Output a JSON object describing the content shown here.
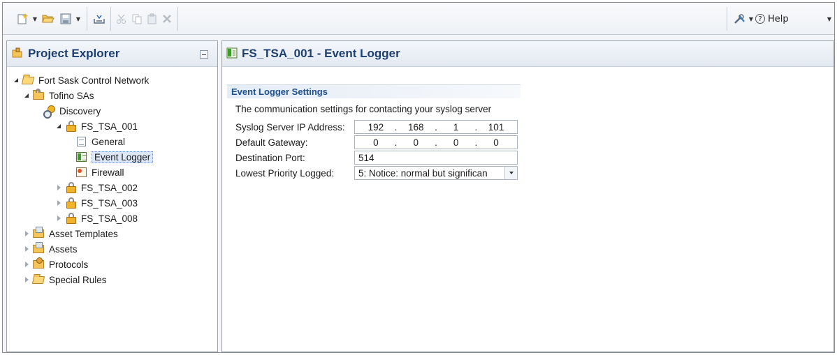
{
  "toolbar": {
    "left_icons": [
      "new-icon",
      "open-folder-icon",
      "save-icon",
      "import-icon",
      "cut-icon",
      "copy-icon",
      "paste-icon",
      "delete-icon"
    ],
    "right_icons": [
      "tools-icon"
    ],
    "help_label": "Help"
  },
  "project_explorer": {
    "title": "Project Explorer",
    "tree": [
      {
        "label": "Fort Sask Control Network",
        "icon": "network-folder-icon",
        "expanded": true
      },
      {
        "label": "Tofino SAs",
        "icon": "tofino-folder-icon",
        "expanded": true
      },
      {
        "label": "Discovery",
        "icon": "discovery-icon"
      },
      {
        "label": "FS_TSA_001",
        "icon": "lock-icon",
        "expanded": true
      },
      {
        "label": "General",
        "icon": "general-document-icon"
      },
      {
        "label": "Event Logger",
        "icon": "event-logger-icon",
        "selected": true
      },
      {
        "label": "Firewall",
        "icon": "firewall-icon"
      },
      {
        "label": "FS_TSA_002",
        "icon": "lock-icon",
        "expanded": false
      },
      {
        "label": "FS_TSA_003",
        "icon": "lock-icon",
        "expanded": false
      },
      {
        "label": "FS_TSA_008",
        "icon": "lock-icon",
        "expanded": false
      },
      {
        "label": "Asset Templates",
        "icon": "asset-templates-folder-icon",
        "expanded": false
      },
      {
        "label": "Assets",
        "icon": "assets-folder-icon",
        "expanded": false
      },
      {
        "label": "Protocols",
        "icon": "protocols-folder-icon",
        "expanded": false
      },
      {
        "label": "Special Rules",
        "icon": "special-rules-folder-icon",
        "expanded": false
      }
    ]
  },
  "editor": {
    "title": "FS_TSA_001 - Event Logger",
    "section_title": "Event Logger Settings",
    "description": "The communication settings for contacting your syslog server",
    "fields": {
      "ip_label": "Syslog Server IP Address:",
      "ip_octets": [
        "192",
        "168",
        "1",
        "101"
      ],
      "gateway_label": "Default Gateway:",
      "gateway_octets": [
        "0",
        "0",
        "0",
        "0"
      ],
      "port_label": "Destination Port:",
      "port_value": "514",
      "priority_label": "Lowest Priority Logged:",
      "priority_value": "5: Notice: normal but significan"
    }
  },
  "colors": {
    "title_text": "#1c3f73",
    "section_title": "#1e4f8f",
    "selection_bg": "#dce8f8"
  }
}
